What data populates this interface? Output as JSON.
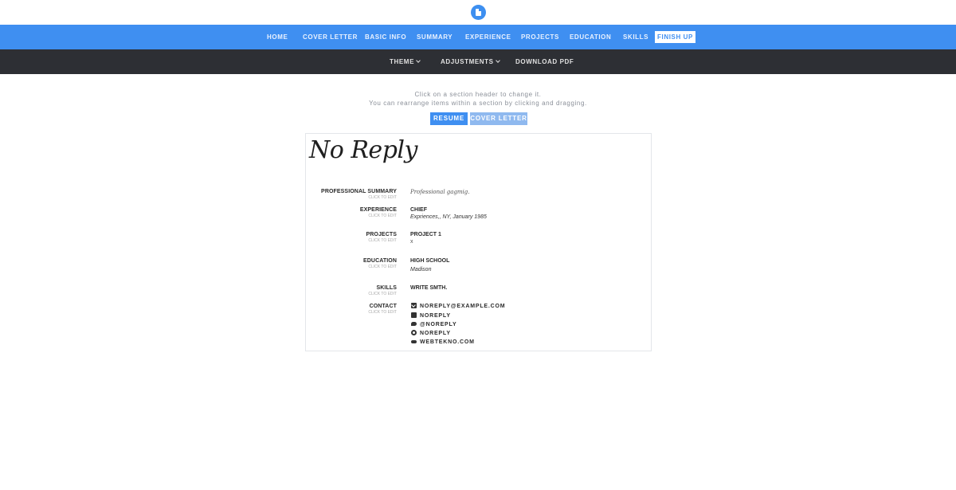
{
  "nav": {
    "items": [
      "Home",
      "Cover Letter",
      "Basic Info",
      "Summary",
      "Experience",
      "Projects",
      "Education",
      "Skills"
    ],
    "finish": "Finish up"
  },
  "toolbar": {
    "theme": "Theme",
    "adjustments": "Adjustments",
    "download": "Download PDF"
  },
  "hint": {
    "line1": "Click on a section header to change it.",
    "line2": "You can rearrange items within a section by clicking and dragging."
  },
  "tabs": {
    "resume": "Resume",
    "cover_letter": "Cover Letter"
  },
  "resume": {
    "name": "No Reply",
    "edit_hint": "Click to edit",
    "sections": {
      "summary": {
        "label": "Professional Summary",
        "text": "Professional gagmig."
      },
      "experience": {
        "label": "Experience",
        "title": "Chief",
        "sub": "Expriences,, NY, January 1985"
      },
      "projects": {
        "label": "Projects",
        "title": "Project 1",
        "text": "x"
      },
      "education": {
        "label": "Education",
        "title": "High School",
        "sub": "Madison"
      },
      "skills": {
        "label": "Skills",
        "title": "Write smth."
      },
      "contact": {
        "label": "Contact",
        "items": [
          {
            "icon": "mail-icon",
            "text": "NOREPLY@EXAMPLE.COM"
          },
          {
            "icon": "linkedin-icon",
            "text": "NOREPLY"
          },
          {
            "icon": "twitter-icon",
            "text": "@NOREPLY"
          },
          {
            "icon": "github-icon",
            "text": "NOREPLY"
          },
          {
            "icon": "cloud-icon",
            "text": "WEBTEKNO.COM"
          }
        ]
      }
    }
  },
  "colors": {
    "primary": "#3f8ff1",
    "dark_bar": "#2d2f34",
    "tab_active": "#3f8ff1",
    "tab_inactive": "#8fb9ef"
  }
}
